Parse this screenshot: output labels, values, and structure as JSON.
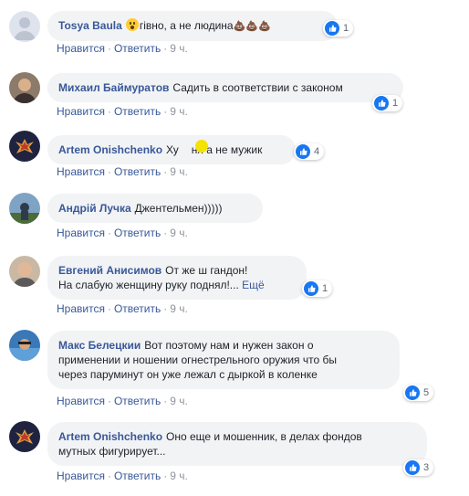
{
  "actions": {
    "like": "Нравится",
    "reply": "Ответить",
    "sep": "·"
  },
  "comments": [
    {
      "author": "Tosya Baula",
      "text": "гівно, а не людина",
      "likes": "1",
      "time": "9 ч.",
      "emoji_prefix": "face-screaming-icon",
      "emoji_suffix": "💩💩💩"
    },
    {
      "author": "Михаил Баймуратов",
      "text": "Садить в соответствии с законом",
      "likes": "1",
      "time": "9 ч."
    },
    {
      "author": "Artem Onishchenko",
      "text_before": "Ху",
      "text_after": "ня а не мужик",
      "likes": "4",
      "time": "9 ч."
    },
    {
      "author": "Андрій Лучка",
      "text": "Джентельмен)))))",
      "time": "9 ч."
    },
    {
      "author": "Евгений Анисимов",
      "text_line1": "От же ш гандон!",
      "text_line2": "На слабую женщину руку поднял!...",
      "more": "Ещё",
      "likes": "1",
      "time": "9 ч."
    },
    {
      "author": "Макс Белецкии",
      "text_line1": "Вот поэтому нам и нужен закон о",
      "text_line2": "применении и ношении огнестрельного оружия что бы",
      "text_line3": "через паруминут он уже лежал с дыркой в коленке",
      "likes": "5",
      "time": "9 ч."
    },
    {
      "author": "Artem Onishchenko",
      "text_line1": "Оно еще и мошенник, в делах фондов",
      "text_line2": "мутных фигурирует...",
      "likes": "3",
      "time": "9 ч."
    }
  ],
  "colors": {
    "author": "#385898",
    "like_badge": "#1877f2",
    "bubble": "#f2f3f5",
    "meta": "#90949c"
  }
}
